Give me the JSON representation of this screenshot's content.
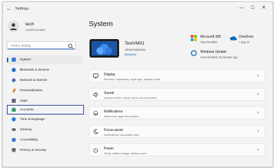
{
  "window": {
    "title": "Settings",
    "back": "←",
    "minimize": "—",
    "maximize": "☐",
    "close": "✕"
  },
  "user": {
    "name": "tech",
    "account": "Local Account"
  },
  "search": {
    "placeholder": "Find a setting"
  },
  "sidebar": {
    "items": [
      {
        "label": "System",
        "icon": "system-icon",
        "color": "#3a7bd5"
      },
      {
        "label": "Bluetooth & devices",
        "icon": "bluetooth-icon",
        "color": "#2d6fd1"
      },
      {
        "label": "Network & internet",
        "icon": "network-icon",
        "color": "#4a6ea8"
      },
      {
        "label": "Personalization",
        "icon": "brush-icon",
        "color": "#e08a3c"
      },
      {
        "label": "Apps",
        "icon": "apps-icon",
        "color": "#6b6b8a"
      },
      {
        "label": "Accounts",
        "icon": "person-icon",
        "color": "#2f9e6e"
      },
      {
        "label": "Time & language",
        "icon": "globe-icon",
        "color": "#2f7bd1"
      },
      {
        "label": "Gaming",
        "icon": "gamepad-icon",
        "color": "#6e6e6e"
      },
      {
        "label": "Accessibility",
        "icon": "accessibility-icon",
        "color": "#3b78c9"
      },
      {
        "label": "Privacy & security",
        "icon": "shield-icon",
        "color": "#6f6f7a"
      }
    ]
  },
  "main": {
    "title": "System",
    "device": {
      "name": "TestVM01",
      "model": "Virtual Machine",
      "rename": "Rename"
    },
    "tiles": [
      {
        "title": "Microsoft 365",
        "sub": "View benefits",
        "icon": "microsoft365-icon"
      },
      {
        "title": "OneDrive",
        "sub": "• Sign in",
        "icon": "onedrive-icon"
      },
      {
        "title": "Windows Update",
        "sub": "Last checked: 16 minutes ago",
        "icon": "windows-update-icon"
      }
    ],
    "cards": [
      {
        "title": "Display",
        "sub": "Monitors, brightness, night light, display profile",
        "icon": "display-icon"
      },
      {
        "title": "Sound",
        "sub": "Volume levels, output, input, sound devices",
        "icon": "speaker-icon"
      },
      {
        "title": "Notifications",
        "sub": "Alerts from apps and system",
        "icon": "bell-icon"
      },
      {
        "title": "Focus assist",
        "sub": "Notifications, automatic rules",
        "icon": "moon-icon"
      },
      {
        "title": "Power",
        "sub": "Sleep, battery usage, battery saver",
        "icon": "power-icon"
      }
    ]
  },
  "colors": {
    "accent": "#1a5fb4",
    "highlight_box": "#2b3a9c"
  }
}
